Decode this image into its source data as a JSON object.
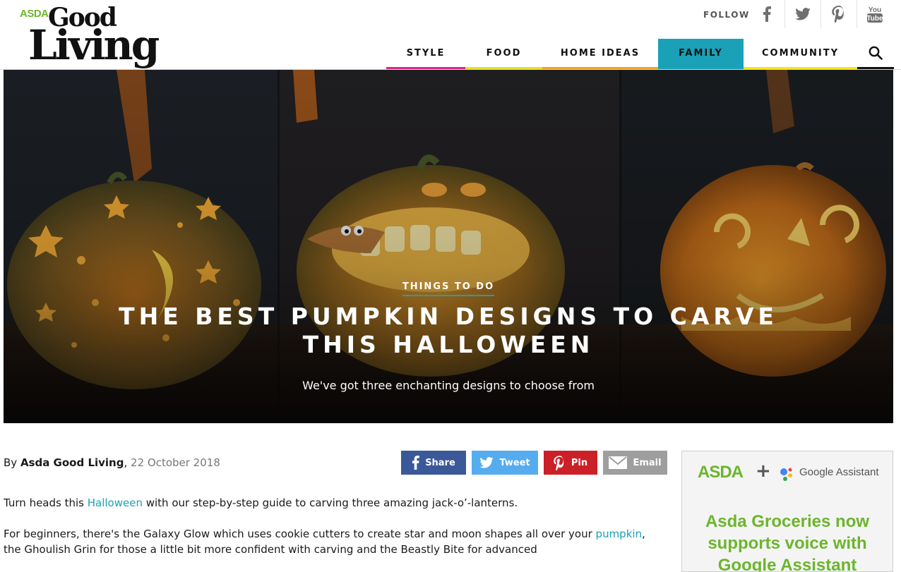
{
  "brand": {
    "asda": "ASDA",
    "good": "Good",
    "living": "Living"
  },
  "header": {
    "follow_label": "FOLLOW",
    "social": [
      "facebook-icon",
      "twitter-icon",
      "pinterest-icon",
      "youtube-icon"
    ]
  },
  "nav": {
    "items": [
      {
        "label": "STYLE",
        "underline": "#d6268b",
        "active": false
      },
      {
        "label": "FOOD",
        "underline": "#e3e01c",
        "active": false
      },
      {
        "label": "HOME IDEAS",
        "underline": "#f0a11e",
        "active": false
      },
      {
        "label": "FAMILY",
        "underline": "#1aa1b7",
        "active": true
      },
      {
        "label": "COMMUNITY",
        "underline": "#f5e512",
        "active": false
      }
    ],
    "search_icon": "search-icon",
    "active_bg": "#1aa1b7"
  },
  "hero": {
    "kicker": "THINGS TO DO",
    "title": "THE BEST PUMPKIN DESIGNS TO CARVE THIS HALLOWEEN",
    "subtitle": "We've got three enchanting designs to choose from"
  },
  "byline": {
    "prefix": "By ",
    "author": "Asda Good Living",
    "separator": ", ",
    "date": "22 October 2018"
  },
  "share": {
    "facebook": {
      "label": "Share",
      "color": "#3b5998"
    },
    "twitter": {
      "label": "Tweet",
      "color": "#55acee"
    },
    "pinterest": {
      "label": "Pin",
      "color": "#cb2027"
    },
    "email": {
      "label": "Email",
      "color": "#9e9e9e"
    }
  },
  "article": {
    "p1_before": "Turn heads this ",
    "p1_link": "Halloween",
    "p1_after": " with our step-by-step guide to carving three amazing jack-o’-lanterns.",
    "p2_before": "For beginners, there's the Galaxy Glow which uses cookie cutters to create star and moon shapes all over your ",
    "p2_link": "pumpkin",
    "p2_after": ", the Ghoulish Grin for those a little bit more confident with carving and the Beastly Bite for advanced"
  },
  "ad": {
    "asda": "ASDA",
    "plus": "+",
    "assistant": "Google Assistant",
    "headline": "Asda Groceries now supports voice with Google Assistant"
  }
}
